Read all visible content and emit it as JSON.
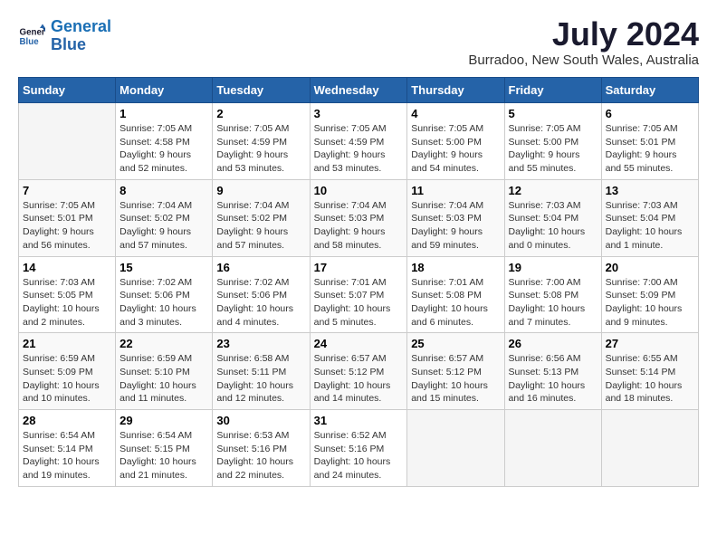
{
  "logo": {
    "line1": "General",
    "line2": "Blue"
  },
  "title": "July 2024",
  "location": "Burradoo, New South Wales, Australia",
  "days_header": [
    "Sunday",
    "Monday",
    "Tuesday",
    "Wednesday",
    "Thursday",
    "Friday",
    "Saturday"
  ],
  "weeks": [
    [
      {
        "num": "",
        "info": ""
      },
      {
        "num": "1",
        "info": "Sunrise: 7:05 AM\nSunset: 4:58 PM\nDaylight: 9 hours\nand 52 minutes."
      },
      {
        "num": "2",
        "info": "Sunrise: 7:05 AM\nSunset: 4:59 PM\nDaylight: 9 hours\nand 53 minutes."
      },
      {
        "num": "3",
        "info": "Sunrise: 7:05 AM\nSunset: 4:59 PM\nDaylight: 9 hours\nand 53 minutes."
      },
      {
        "num": "4",
        "info": "Sunrise: 7:05 AM\nSunset: 5:00 PM\nDaylight: 9 hours\nand 54 minutes."
      },
      {
        "num": "5",
        "info": "Sunrise: 7:05 AM\nSunset: 5:00 PM\nDaylight: 9 hours\nand 55 minutes."
      },
      {
        "num": "6",
        "info": "Sunrise: 7:05 AM\nSunset: 5:01 PM\nDaylight: 9 hours\nand 55 minutes."
      }
    ],
    [
      {
        "num": "7",
        "info": "Sunrise: 7:05 AM\nSunset: 5:01 PM\nDaylight: 9 hours\nand 56 minutes."
      },
      {
        "num": "8",
        "info": "Sunrise: 7:04 AM\nSunset: 5:02 PM\nDaylight: 9 hours\nand 57 minutes."
      },
      {
        "num": "9",
        "info": "Sunrise: 7:04 AM\nSunset: 5:02 PM\nDaylight: 9 hours\nand 57 minutes."
      },
      {
        "num": "10",
        "info": "Sunrise: 7:04 AM\nSunset: 5:03 PM\nDaylight: 9 hours\nand 58 minutes."
      },
      {
        "num": "11",
        "info": "Sunrise: 7:04 AM\nSunset: 5:03 PM\nDaylight: 9 hours\nand 59 minutes."
      },
      {
        "num": "12",
        "info": "Sunrise: 7:03 AM\nSunset: 5:04 PM\nDaylight: 10 hours\nand 0 minutes."
      },
      {
        "num": "13",
        "info": "Sunrise: 7:03 AM\nSunset: 5:04 PM\nDaylight: 10 hours\nand 1 minute."
      }
    ],
    [
      {
        "num": "14",
        "info": "Sunrise: 7:03 AM\nSunset: 5:05 PM\nDaylight: 10 hours\nand 2 minutes."
      },
      {
        "num": "15",
        "info": "Sunrise: 7:02 AM\nSunset: 5:06 PM\nDaylight: 10 hours\nand 3 minutes."
      },
      {
        "num": "16",
        "info": "Sunrise: 7:02 AM\nSunset: 5:06 PM\nDaylight: 10 hours\nand 4 minutes."
      },
      {
        "num": "17",
        "info": "Sunrise: 7:01 AM\nSunset: 5:07 PM\nDaylight: 10 hours\nand 5 minutes."
      },
      {
        "num": "18",
        "info": "Sunrise: 7:01 AM\nSunset: 5:08 PM\nDaylight: 10 hours\nand 6 minutes."
      },
      {
        "num": "19",
        "info": "Sunrise: 7:00 AM\nSunset: 5:08 PM\nDaylight: 10 hours\nand 7 minutes."
      },
      {
        "num": "20",
        "info": "Sunrise: 7:00 AM\nSunset: 5:09 PM\nDaylight: 10 hours\nand 9 minutes."
      }
    ],
    [
      {
        "num": "21",
        "info": "Sunrise: 6:59 AM\nSunset: 5:09 PM\nDaylight: 10 hours\nand 10 minutes."
      },
      {
        "num": "22",
        "info": "Sunrise: 6:59 AM\nSunset: 5:10 PM\nDaylight: 10 hours\nand 11 minutes."
      },
      {
        "num": "23",
        "info": "Sunrise: 6:58 AM\nSunset: 5:11 PM\nDaylight: 10 hours\nand 12 minutes."
      },
      {
        "num": "24",
        "info": "Sunrise: 6:57 AM\nSunset: 5:12 PM\nDaylight: 10 hours\nand 14 minutes."
      },
      {
        "num": "25",
        "info": "Sunrise: 6:57 AM\nSunset: 5:12 PM\nDaylight: 10 hours\nand 15 minutes."
      },
      {
        "num": "26",
        "info": "Sunrise: 6:56 AM\nSunset: 5:13 PM\nDaylight: 10 hours\nand 16 minutes."
      },
      {
        "num": "27",
        "info": "Sunrise: 6:55 AM\nSunset: 5:14 PM\nDaylight: 10 hours\nand 18 minutes."
      }
    ],
    [
      {
        "num": "28",
        "info": "Sunrise: 6:54 AM\nSunset: 5:14 PM\nDaylight: 10 hours\nand 19 minutes."
      },
      {
        "num": "29",
        "info": "Sunrise: 6:54 AM\nSunset: 5:15 PM\nDaylight: 10 hours\nand 21 minutes."
      },
      {
        "num": "30",
        "info": "Sunrise: 6:53 AM\nSunset: 5:16 PM\nDaylight: 10 hours\nand 22 minutes."
      },
      {
        "num": "31",
        "info": "Sunrise: 6:52 AM\nSunset: 5:16 PM\nDaylight: 10 hours\nand 24 minutes."
      },
      {
        "num": "",
        "info": ""
      },
      {
        "num": "",
        "info": ""
      },
      {
        "num": "",
        "info": ""
      }
    ]
  ]
}
